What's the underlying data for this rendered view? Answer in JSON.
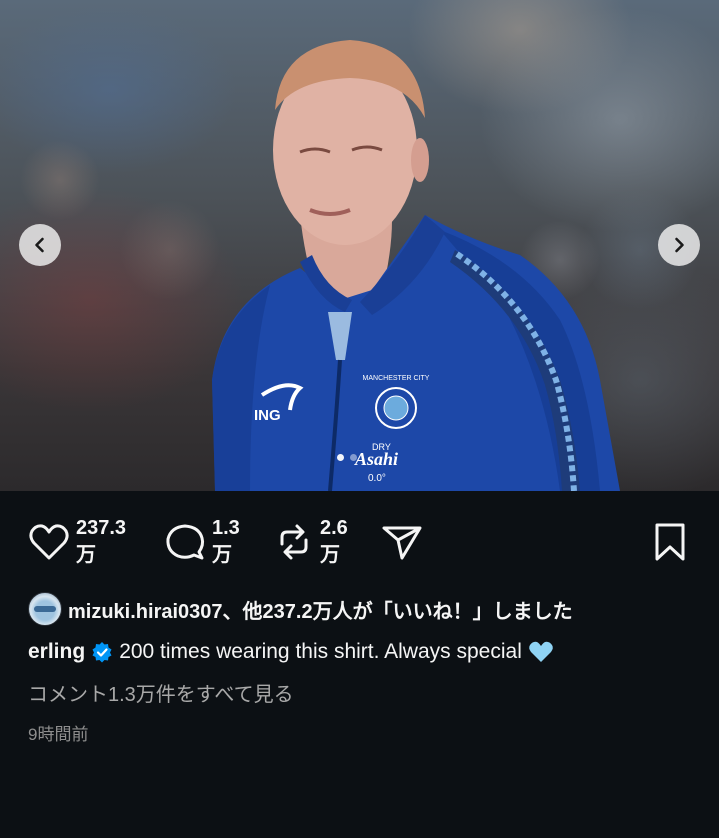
{
  "post": {
    "carousel": {
      "prev_icon": "chevron-left-icon",
      "next_icon": "chevron-right-icon",
      "dot_count": 2,
      "active_dot": 0,
      "image": {
        "shirt_text_brand": "ING",
        "shirt_sponsor": "Asahi",
        "shirt_sponsor_top": "DRY",
        "shirt_sponsor_bottom": "0.0°",
        "badge_text": "MANCHESTER CITY"
      }
    },
    "actions": {
      "like_count": "237.3\n万",
      "like_line1": "237.3",
      "like_line2": "万",
      "comment_line1": "1.3",
      "comment_line2": "万",
      "repost_line1": "2.6",
      "repost_line2": "万",
      "icons": [
        "heart-icon",
        "comment-icon",
        "repost-icon",
        "share-icon",
        "bookmark-icon"
      ]
    },
    "likes": {
      "text": "mizuki.hirai0307、他237.2万人が「いいね！」しました"
    },
    "caption": {
      "username": "erling",
      "text": "200 times wearing this shirt. Always special"
    },
    "view_comments": "コメント1.3万件をすべて見る",
    "time": "9時間前"
  },
  "colors": {
    "background": "#0c1014",
    "verified": "#0095f6",
    "heart_emoji": "#8fd3f4",
    "jacket": "#1d48a8"
  }
}
